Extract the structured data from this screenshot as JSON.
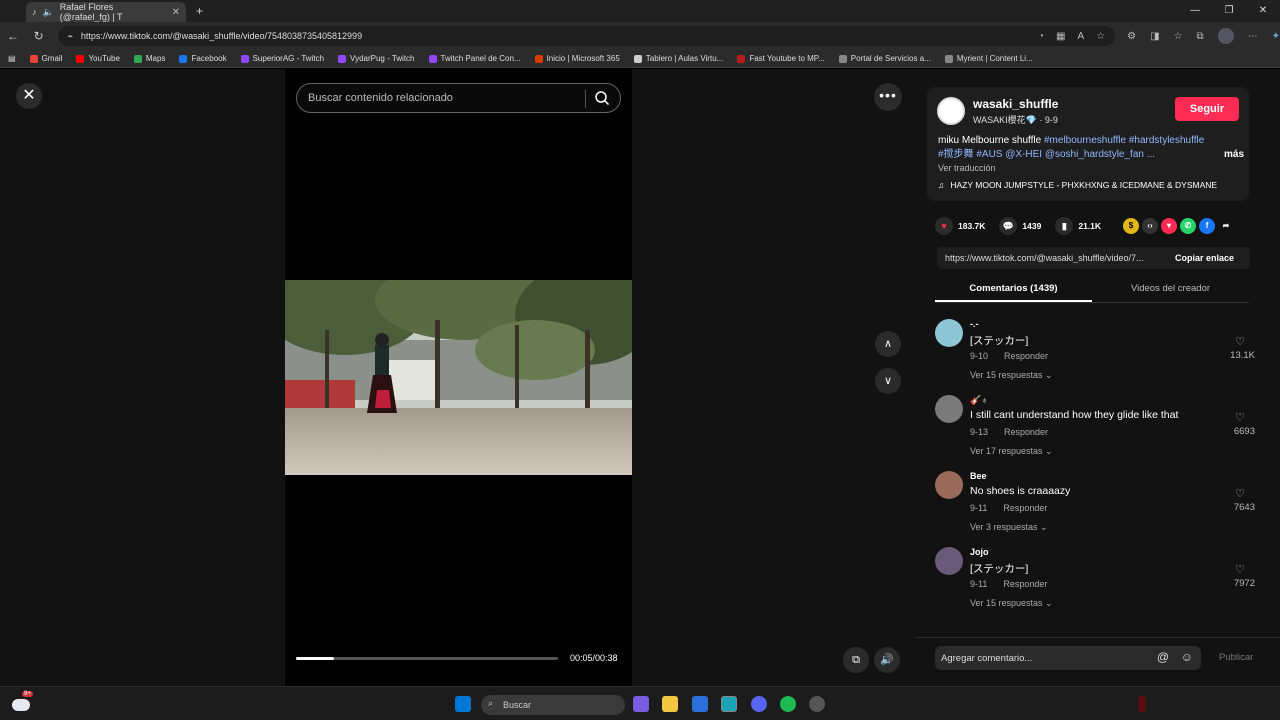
{
  "browser": {
    "tab_title": "Rafael Flores (@rafael_fg) | T",
    "tab_close": "✕",
    "new_tab": "+",
    "url": "https://www.tiktok.com/@wasaki_shuffle/video/7548038735405812999",
    "bookmarks": [
      {
        "label": "Gmail",
        "color": "#ea4335"
      },
      {
        "label": "YouTube",
        "color": "#ff0000"
      },
      {
        "label": "Maps",
        "color": "#34a853"
      },
      {
        "label": "Facebook",
        "color": "#1877f2"
      },
      {
        "label": "SuperiorAG - Twitch",
        "color": "#9146ff"
      },
      {
        "label": "VydarPug - Twitch",
        "color": "#9146ff"
      },
      {
        "label": "Twitch Panel de Con...",
        "color": "#9146ff"
      },
      {
        "label": "Inicio | Microsoft 365",
        "color": "#d83b01"
      },
      {
        "label": "Tablero | Aulas Virtu...",
        "color": "#cccccc"
      },
      {
        "label": "Fast Youtube to MP...",
        "color": "#b91d1d"
      },
      {
        "label": "Portal de Servicios a...",
        "color": "#888888"
      },
      {
        "label": "Myrient | Content Li...",
        "color": "#888888"
      }
    ]
  },
  "video": {
    "close_label": "✕",
    "search_placeholder": "Buscar contenido relacionado",
    "more_label": "•••",
    "up_label": "∧",
    "down_label": "∨",
    "progress": 0.145,
    "time": "00:05/00:38"
  },
  "post": {
    "username": "wasaki_shuffle",
    "subtitle": "WASAKI櫻花💎 · 9-9",
    "follow_label": "Seguir",
    "caption_start": "miku Melbourne shuffle ",
    "caption_tags_1": "#melbourneshuffle #hardstyleshuffle",
    "caption_tags_2": "#搅步舞 #AUS @X-HEI @soshi_hardstyle_fan ...",
    "caption_more": "más",
    "translate": "Ver traducción",
    "music": "HAZY MOON JUMPSTYLE - PHXKHXNG & ICEDMANE & DYSMANE",
    "likes": "183.7K",
    "comments_count": "1439",
    "saves": "21.1K",
    "link": "https://www.tiktok.com/@wasaki_shuffle/video/7...",
    "copy_label": "Copiar enlace",
    "tab_comments": "Comentarios (1439)",
    "tab_videos": "Videos del creador"
  },
  "comments": [
    {
      "name": "-.-",
      "text": "[ステッカー]",
      "date": "9-10",
      "reply": "Responder",
      "replies": "Ver 15 respuestas ⌄",
      "likes": "13.1K",
      "avatar": "#8ec6d6"
    },
    {
      "name": "🎸♁",
      "text": "I still cant understand how they glide like that",
      "date": "9-13",
      "reply": "Responder",
      "replies": "Ver 17 respuestas ⌄",
      "likes": "6693",
      "avatar": "#7a7a7a"
    },
    {
      "name": "Bee",
      "text": "No shoes is craaaazy",
      "date": "9-11",
      "reply": "Responder",
      "replies": "Ver 3 respuestas ⌄",
      "likes": "7643",
      "avatar": "#9a6a5a"
    },
    {
      "name": "Jojo",
      "text": "[ステッカー]",
      "date": "9-11",
      "reply": "Responder",
      "replies": "Ver 15 respuestas ⌄",
      "likes": "7972",
      "avatar": "#6a5a7a"
    }
  ],
  "comment_input": {
    "placeholder": "Agregar comentario...",
    "at": "@",
    "emoji": "☺",
    "publish": "Publicar"
  },
  "taskbar": {
    "search": "Buscar",
    "badge": "9+"
  }
}
